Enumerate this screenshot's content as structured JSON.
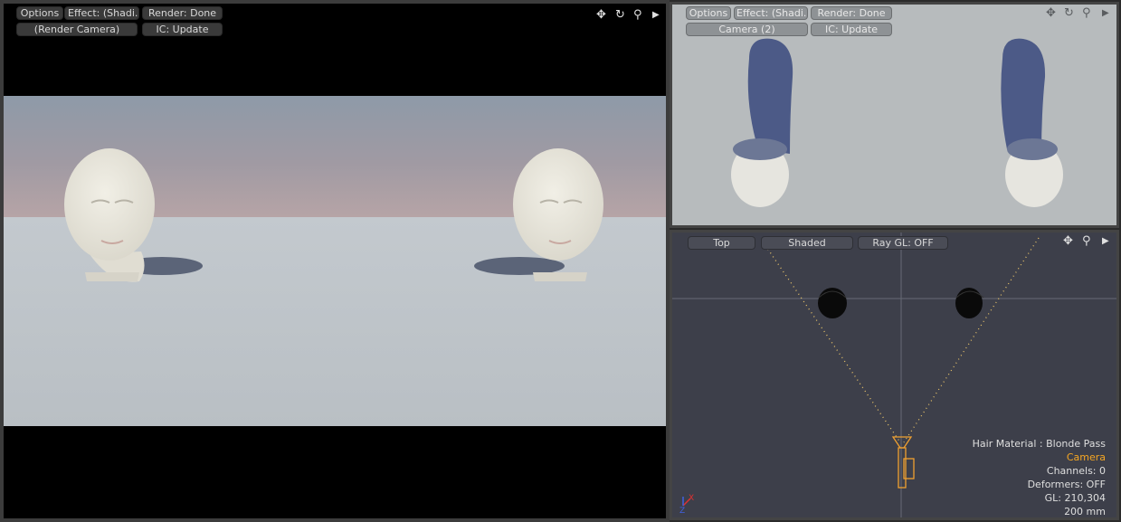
{
  "left_viewport": {
    "options_label": "Options",
    "effect_label": "Effect: (Shadi...",
    "render_label": "Render: Done",
    "camera_label": "(Render Camera)",
    "ic_label": "IC: Update"
  },
  "top_right_viewport": {
    "options_label": "Options",
    "effect_label": "Effect: (Shadi...",
    "render_label": "Render: Done",
    "camera_label": "Camera (2)",
    "ic_label": "IC: Update"
  },
  "bottom_right_viewport": {
    "view_label": "Top",
    "shading_label": "Shaded",
    "raygl_label": "Ray GL: OFF",
    "info": {
      "hair_material": "Hair Material : Blonde Pass",
      "selected": "Camera",
      "channels": "Channels: 0",
      "deformers": "Deformers: OFF",
      "gl": "GL: 210,304",
      "scale": "200 mm"
    },
    "axis": {
      "x": "X",
      "z": "Z"
    }
  },
  "colors": {
    "selected_item": "#f5a623",
    "camera_wire": "#f0a030",
    "axis_x": "#e03030",
    "axis_z": "#4060e0"
  },
  "icons": [
    "move-icon",
    "rotate-icon",
    "zoom-icon",
    "expand-arrow-icon"
  ]
}
